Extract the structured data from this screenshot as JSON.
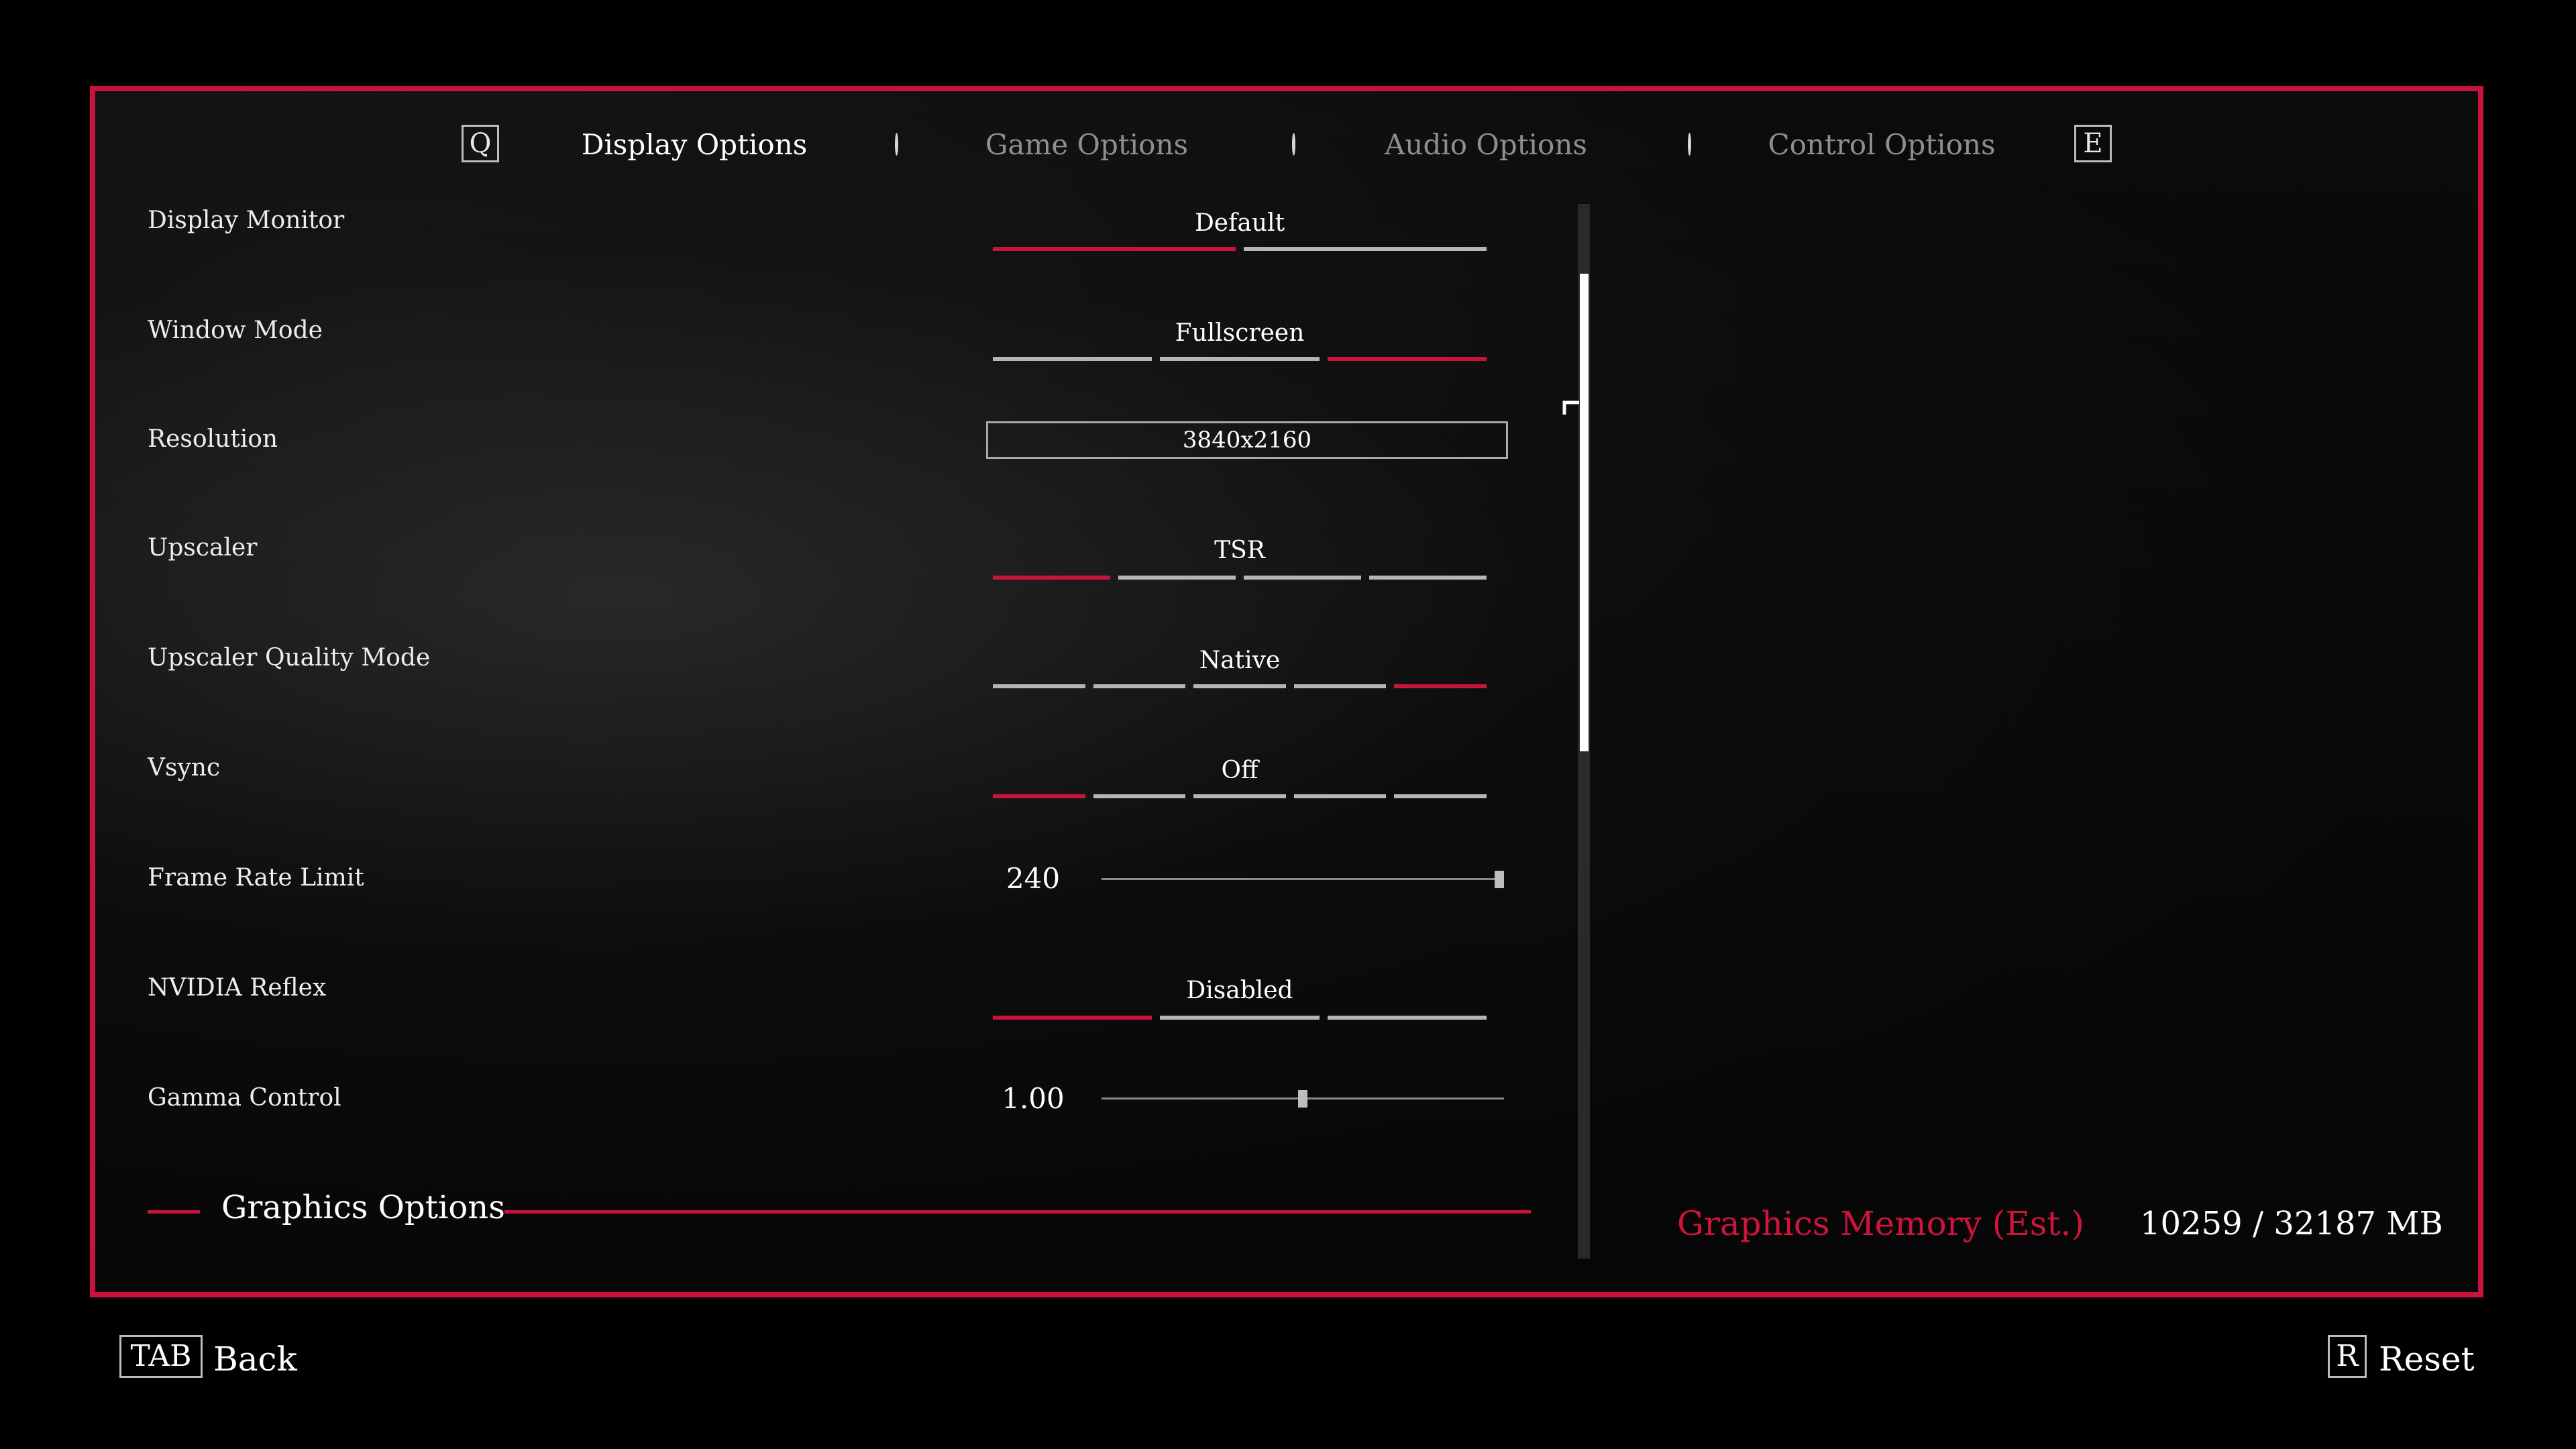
{
  "tabs": {
    "prev_key": "Q",
    "next_key": "E",
    "items": [
      {
        "label": "Display Options",
        "active": true
      },
      {
        "label": "Game Options",
        "active": false
      },
      {
        "label": "Audio Options",
        "active": false
      },
      {
        "label": "Control Options",
        "active": false
      }
    ]
  },
  "settings": {
    "display_monitor": {
      "label": "Display Monitor",
      "value": "Default",
      "segments": 2,
      "selected_index": 0
    },
    "window_mode": {
      "label": "Window Mode",
      "value": "Fullscreen",
      "segments": 3,
      "selected_index": 2
    },
    "resolution": {
      "label": "Resolution",
      "value": "3840x2160"
    },
    "upscaler": {
      "label": "Upscaler",
      "value": "TSR",
      "segments": 4,
      "selected_index": 0
    },
    "upscaler_quality": {
      "label": "Upscaler Quality Mode",
      "value": "Native",
      "segments": 5,
      "selected_index": 4
    },
    "vsync": {
      "label": "Vsync",
      "value": "Off",
      "segments": 5,
      "selected_index": 0
    },
    "frame_rate_limit": {
      "label": "Frame Rate Limit",
      "value": "240",
      "fraction": 1.0
    },
    "nvidia_reflex": {
      "label": "NVIDIA Reflex",
      "value": "Disabled",
      "segments": 3,
      "selected_index": 0
    },
    "gamma_control": {
      "label": "Gamma Control",
      "value": "1.00",
      "fraction": 0.5
    }
  },
  "section": {
    "title": "Graphics Options"
  },
  "memory": {
    "label": "Graphics Memory (Est.)",
    "value": "10259 / 32187 MB"
  },
  "footer": {
    "back_key": "TAB",
    "back_label": "Back",
    "reset_key": "R",
    "reset_label": "Reset"
  },
  "colors": {
    "accent": "#c8143c",
    "inactive_segment": "#b5b5b5",
    "background": "#000000"
  }
}
